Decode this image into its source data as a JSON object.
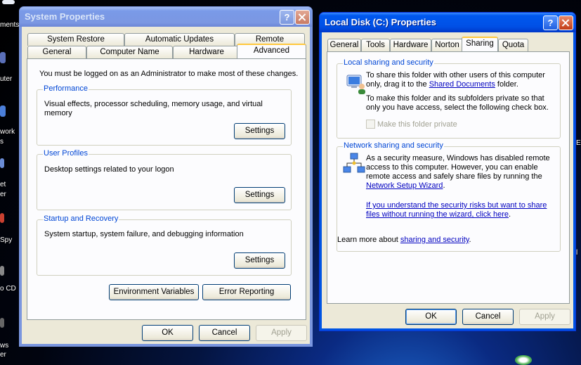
{
  "desktop": {
    "left_labels": [
      "ments",
      "uter",
      "work",
      "s",
      "et",
      "er",
      "Spy",
      "o CD",
      "ws",
      "er"
    ],
    "right_labels": [
      "E",
      "l"
    ]
  },
  "system_properties": {
    "title": "System Properties",
    "tabs_row1": [
      "System Restore",
      "Automatic Updates",
      "Remote"
    ],
    "tabs_row2": [
      "General",
      "Computer Name",
      "Hardware",
      "Advanced"
    ],
    "admin_note": "You must be logged on as an Administrator to make most of these changes.",
    "performance": {
      "title": "Performance",
      "description": "Visual effects, processor scheduling, memory usage, and virtual memory",
      "button": "Settings"
    },
    "user_profiles": {
      "title": "User Profiles",
      "description": "Desktop settings related to your logon",
      "button": "Settings"
    },
    "startup_recovery": {
      "title": "Startup and Recovery",
      "description": "System startup, system failure, and debugging information",
      "button": "Settings"
    },
    "env_vars": "Environment Variables",
    "error_reporting": "Error Reporting",
    "ok": "OK",
    "cancel": "Cancel",
    "apply": "Apply"
  },
  "local_disk": {
    "title": "Local Disk (C:) Properties",
    "tabs": [
      "General",
      "Tools",
      "Hardware",
      "Norton",
      "Sharing",
      "Quota"
    ],
    "local_sharing": {
      "title": "Local sharing and security",
      "p1_a": "To share this folder with other users of this computer",
      "p1_b": "only, drag it to the ",
      "p1_link": "Shared Documents",
      "p1_c": " folder.",
      "p2_a": "To make this folder and its subfolders private so that",
      "p2_b": "only you have access, select the following check box.",
      "checkbox_label": "Make this folder private"
    },
    "network_sharing": {
      "title": "Network sharing and security",
      "l1": "As a security measure, Windows has disabled remote",
      "l2": "access to this computer. However, you can enable",
      "l3": "remote access and safely share files by running the",
      "wizard_link": "Network Setup Wizard",
      "wizard_suffix": ".",
      "risk_link_1": "If you understand the security risks but want to share",
      "risk_link_2": "files without running the wizard, click here",
      "risk_suffix": ".",
      "learn_prefix": "Learn more about ",
      "learn_link": "sharing and security",
      "learn_suffix": "."
    },
    "ok": "OK",
    "cancel": "Cancel",
    "apply": "Apply"
  }
}
